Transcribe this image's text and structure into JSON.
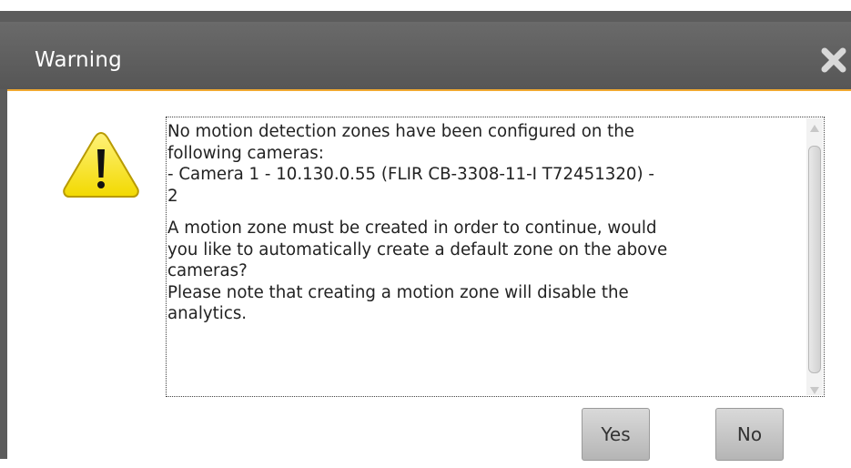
{
  "dialog": {
    "title": "Warning",
    "close_icon": "close-x-icon",
    "warning_icon": "warning-triangle-icon",
    "message_lines": [
      "No motion detection zones have been configured on the",
      "following cameras:",
      "- Camera 1 - 10.130.0.55 (FLIR CB-3308-11-I T72451320) -",
      "2"
    ],
    "message_lines_2": [
      "A motion zone must be created in order to continue, would",
      "you like to automatically create a default zone on the above",
      "cameras?",
      "Please note that creating a motion zone will disable the",
      "analytics."
    ],
    "yes_label": "Yes",
    "no_label": "No"
  },
  "colors": {
    "titlebar": "#5c5c5c",
    "accent_border": "#f0a830",
    "warning_fill": "#f5e800",
    "button": "#c8c8c8"
  }
}
